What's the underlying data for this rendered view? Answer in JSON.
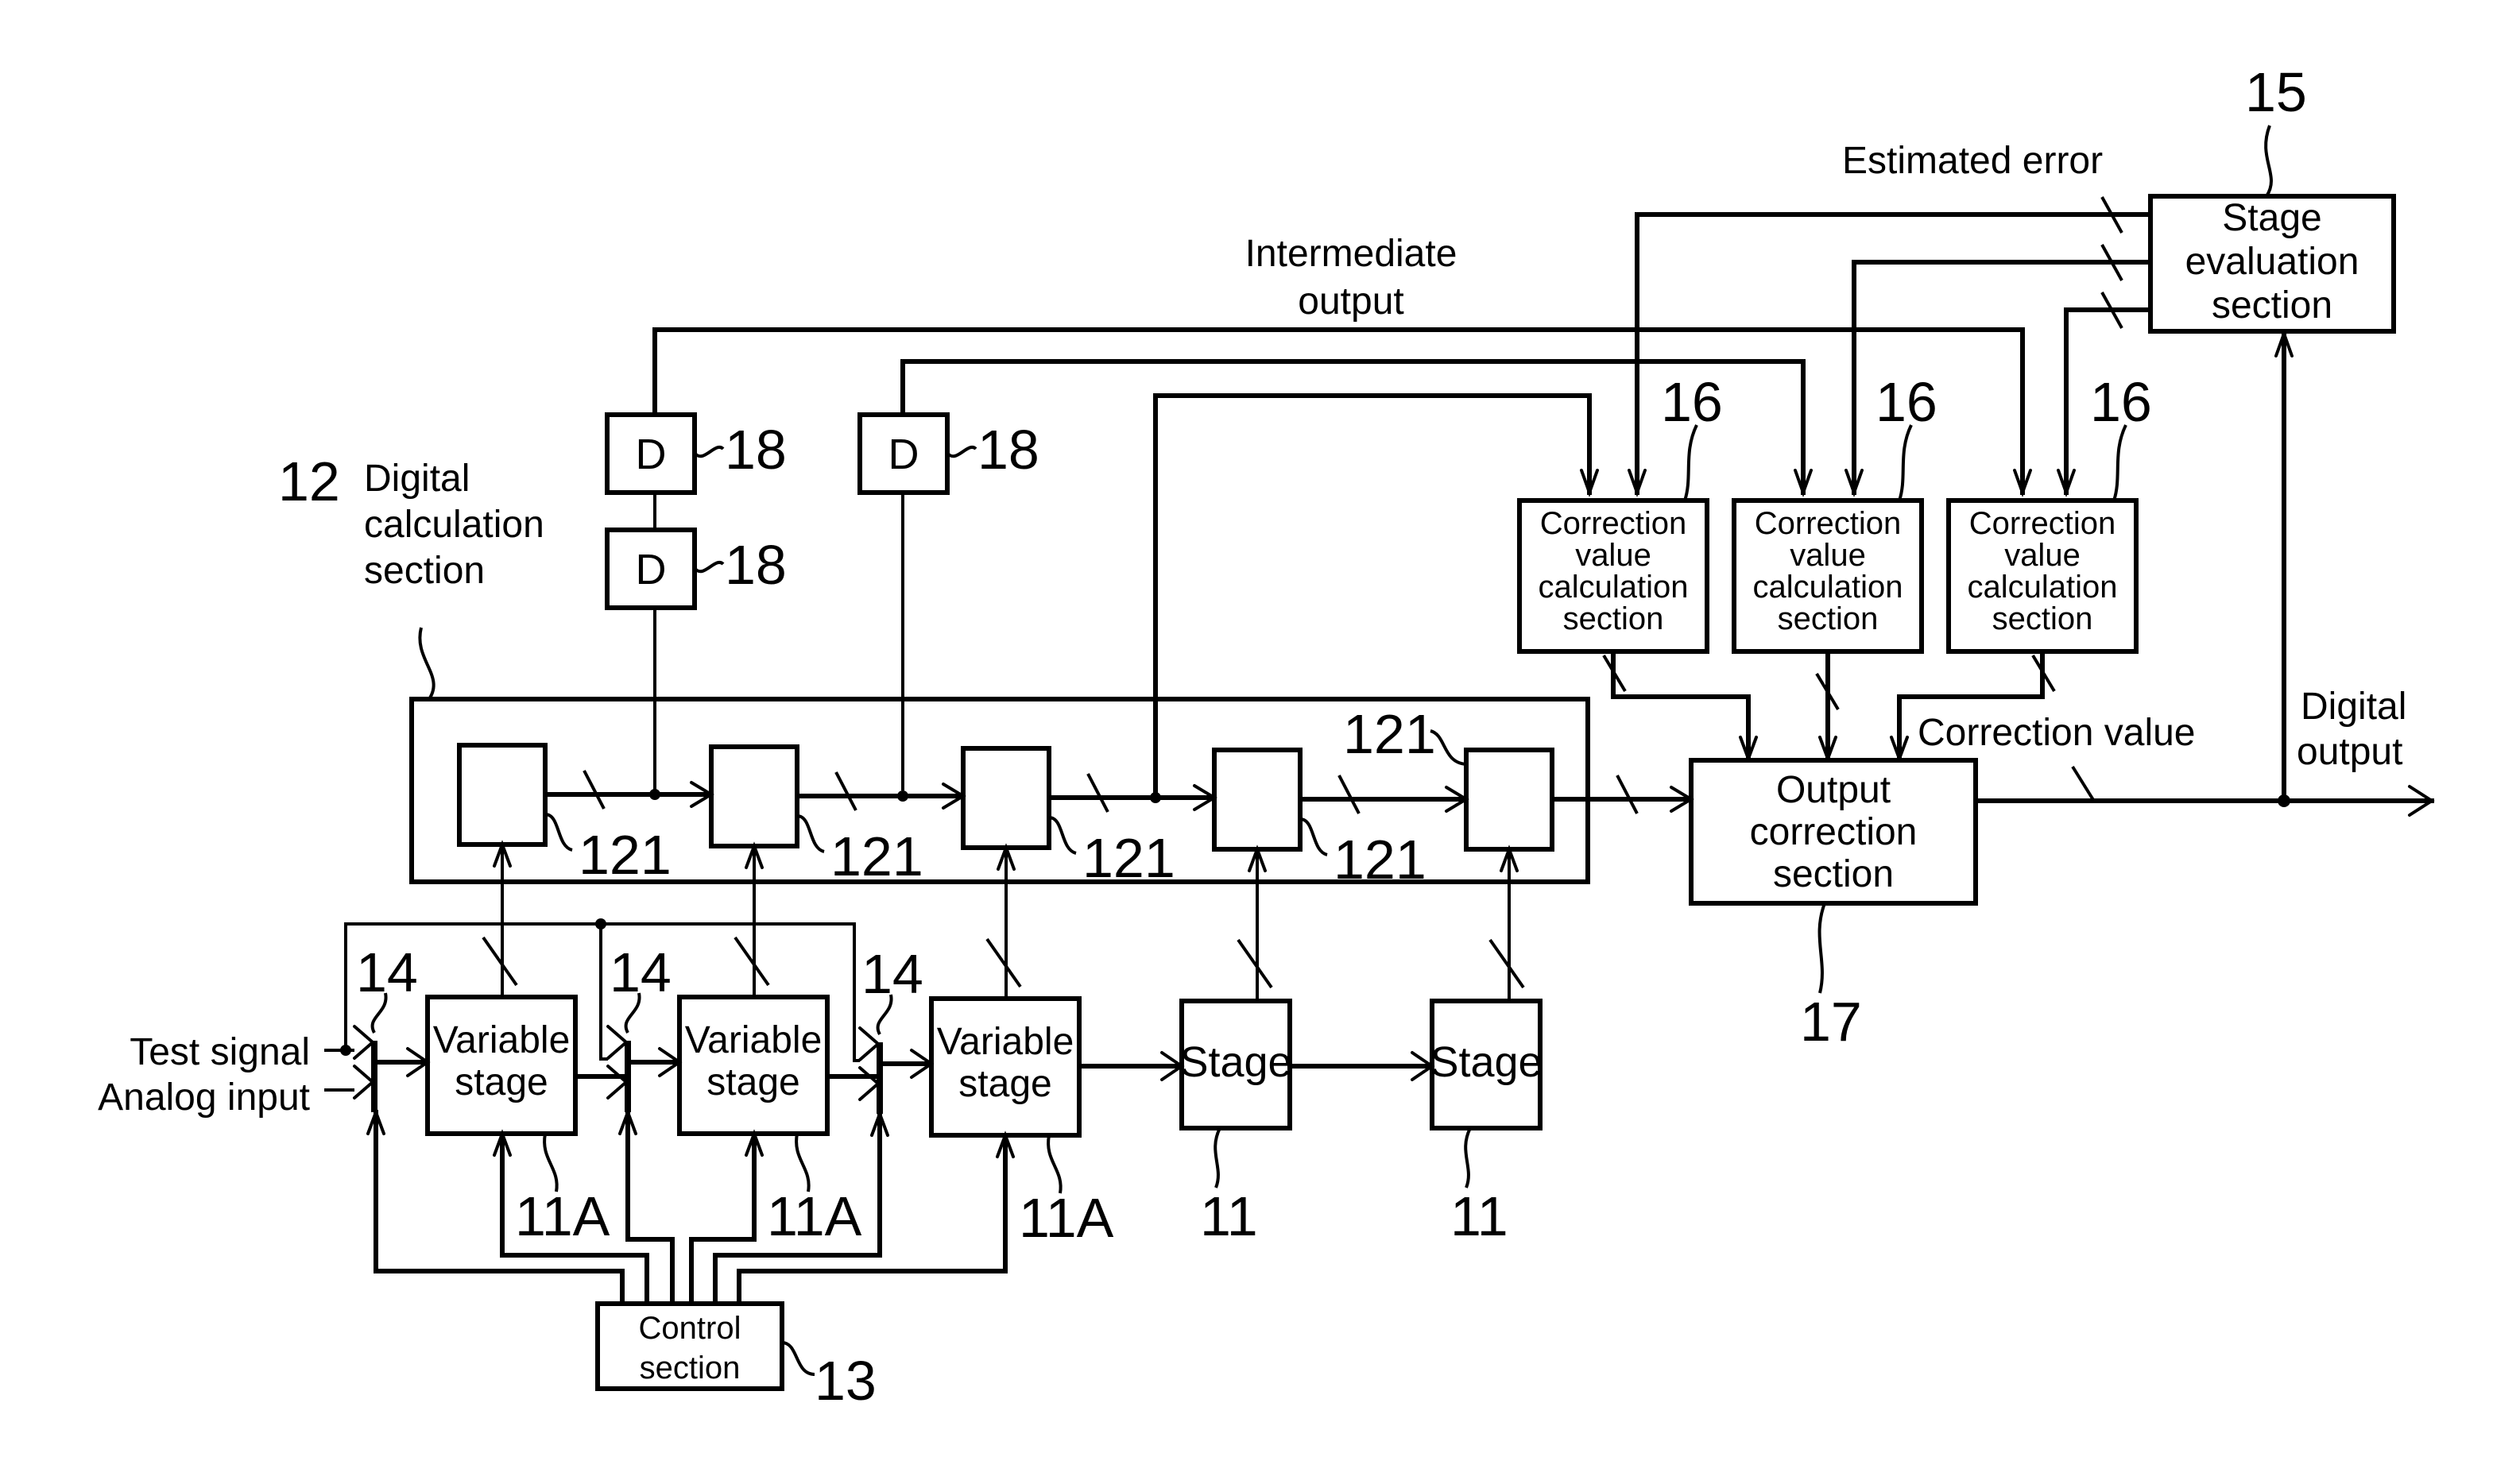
{
  "figure": {
    "annotations": {
      "estimated_error": "Estimated error",
      "intermediate_output_l1": "Intermediate",
      "intermediate_output_l2": "output",
      "correction_value": "Correction value",
      "digital_output_l1": "Digital",
      "digital_output_l2": "output",
      "test_signal": "Test signal",
      "analog_input": "Analog input",
      "digital_calc_l1": "Digital",
      "digital_calc_l2": "calculation",
      "digital_calc_l3": "section"
    },
    "blocks": {
      "stage_evaluation": {
        "lines": [
          "Stage",
          "evaluation",
          "section"
        ],
        "ref": "15"
      },
      "correction_value_calc": {
        "lines": [
          "Correction",
          "value",
          "calculation",
          "section"
        ],
        "ref": "16"
      },
      "output_correction": {
        "lines": [
          "Output",
          "correction",
          "section"
        ],
        "ref": "17"
      },
      "delay": {
        "label": "D",
        "ref": "18"
      },
      "digital_calc": {
        "ref": "12"
      },
      "digital_calc_unit": {
        "ref": "121"
      },
      "variable_stage": {
        "lines": [
          "Variable",
          "stage"
        ],
        "ref": "11A"
      },
      "stage": {
        "label": "Stage",
        "ref": "11"
      },
      "switch": {
        "ref": "14"
      },
      "control": {
        "lines": [
          "Control",
          "section"
        ],
        "ref": "13"
      }
    }
  }
}
